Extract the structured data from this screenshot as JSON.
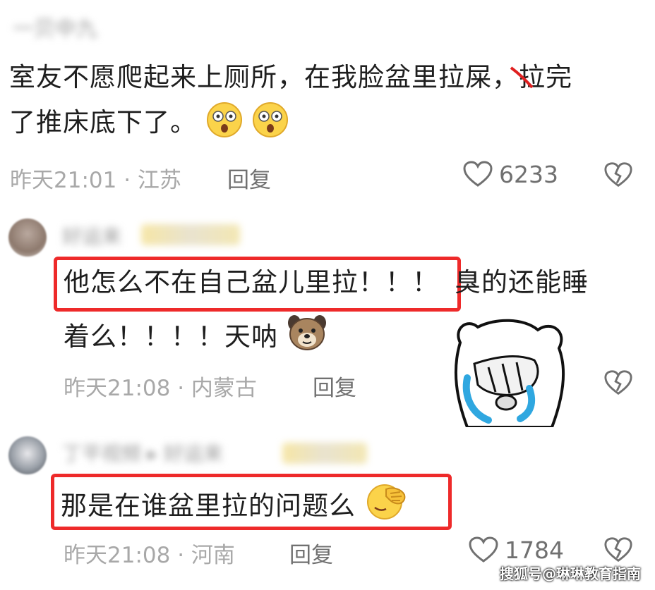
{
  "comment1": {
    "username": "一贝中九",
    "text_line1": "室友不愿爬起来上厕所，在我脸盆里拉屎，拉完",
    "text_line2": "了推床底下了。",
    "time": "昨天21:01",
    "location": "江苏",
    "reply_label": "回复",
    "like_count": "6233"
  },
  "comment2": {
    "username": "好运来",
    "highlighted_text": "他怎么不在自己盆儿里拉！！！",
    "text_line1_rest": "臭的还能睡",
    "text_line2": "着么！！！！天呐",
    "time": "昨天21:08",
    "location": "内蒙古",
    "reply_label": "回复"
  },
  "comment3": {
    "username": "丁平视频 ▸ 好运来",
    "highlighted_text": "那是在谁盆里拉的问题么",
    "time": "昨天21:08",
    "location": "河南",
    "reply_label": "回复",
    "like_count": "1784"
  },
  "watermark": "搜狐号@琳琳教育指南",
  "icons": {
    "like": "heart-outline-icon",
    "dislike": "broken-heart-icon",
    "emoji_shocked": "shocked-face-emoji",
    "emoji_dog": "dog-face-emoji",
    "emoji_facepalm": "facepalm-emoji",
    "sticker": "crying-bear-sticker"
  },
  "colors": {
    "highlight_box": "#ee2a2a",
    "meta_text": "#a8a8a8"
  }
}
